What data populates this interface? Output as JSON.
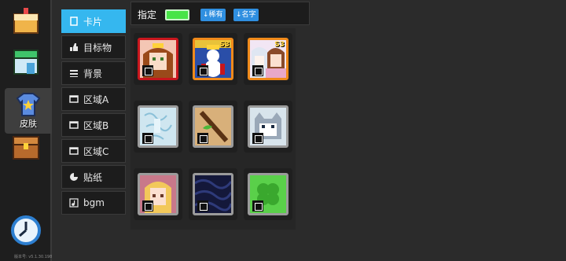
{
  "sidebar": {
    "skin_label": "皮肤",
    "version": "版本号: v5.1.30.198",
    "items": [
      {
        "icon": "cake-icon"
      },
      {
        "icon": "shop-icon"
      },
      {
        "icon": "shirt-icon"
      },
      {
        "icon": "chest-icon"
      },
      {
        "icon": "clock-icon"
      }
    ]
  },
  "tabs": [
    {
      "label": "卡片",
      "icon": "card-icon",
      "active": true
    },
    {
      "label": "目标物",
      "icon": "thumb-icon"
    },
    {
      "label": "背景",
      "icon": "background-icon"
    },
    {
      "label": "区域A",
      "icon": "area-icon"
    },
    {
      "label": "区域B",
      "icon": "area-icon"
    },
    {
      "label": "区域C",
      "icon": "area-icon"
    },
    {
      "label": "贴纸",
      "icon": "sticker-icon"
    },
    {
      "label": "bgm",
      "icon": "music-icon"
    }
  ],
  "topbar": {
    "title": "指定",
    "sort_owned": "↓稀有",
    "sort_name": "↓名字"
  },
  "grid": [
    {
      "name": "princess-card",
      "border": "#c8161d",
      "badge": ""
    },
    {
      "name": "snowman-king-card",
      "border": "#f08a1a",
      "badge": "S3"
    },
    {
      "name": "anime-girl-card",
      "border": "#f08a1a",
      "badge": "S3"
    },
    {
      "name": "frost-card",
      "border": "#9b9b9b",
      "badge": ""
    },
    {
      "name": "stick-card",
      "border": "#9b9b9b",
      "badge": ""
    },
    {
      "name": "cat-card",
      "border": "#9b9b9b",
      "badge": ""
    },
    {
      "name": "blonde-girl-card",
      "border": "#9b9b9b",
      "badge": ""
    },
    {
      "name": "night-wave-card",
      "border": "#9b9b9b",
      "badge": ""
    },
    {
      "name": "clover-card",
      "border": "#9b9b9b",
      "badge": ""
    }
  ]
}
